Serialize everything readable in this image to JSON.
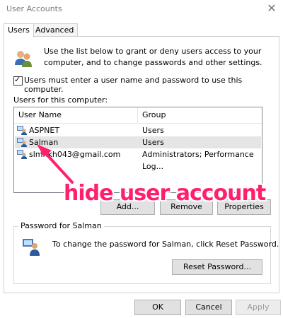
{
  "window": {
    "title": "User Accounts",
    "close_glyph": "✕"
  },
  "tabs": [
    {
      "label": "Users",
      "active": true
    },
    {
      "label": "Advanced",
      "active": false
    }
  ],
  "intro_text": "Use the list below to grant or deny users access to your computer, and to change passwords and other settings.",
  "require_login": {
    "checked": true,
    "label": "Users must enter a user name and password to use this computer."
  },
  "users_label": "Users for this computer:",
  "table": {
    "columns": [
      "User Name",
      "Group"
    ],
    "rows": [
      {
        "name": "ASPNET",
        "group": "Users",
        "selected": false
      },
      {
        "name": "Salman",
        "group": "Users",
        "selected": true
      },
      {
        "name": "slmnkh043@gmail.com",
        "group": "Administrators; Performance Log...",
        "selected": false
      }
    ]
  },
  "buttons": {
    "add": "Add...",
    "remove": "Remove",
    "properties": "Properties",
    "reset_password": "Reset Password...",
    "ok": "OK",
    "cancel": "Cancel",
    "apply": "Apply"
  },
  "password_group": {
    "legend": "Password for Salman",
    "text": "To change the password for Salman, click Reset Password."
  },
  "annotation": {
    "text": "hide user account",
    "color": "#ff1f6e"
  },
  "icons": {
    "users": "users-icon",
    "user": "user-icon",
    "password": "password-user-icon",
    "close": "close-icon"
  }
}
